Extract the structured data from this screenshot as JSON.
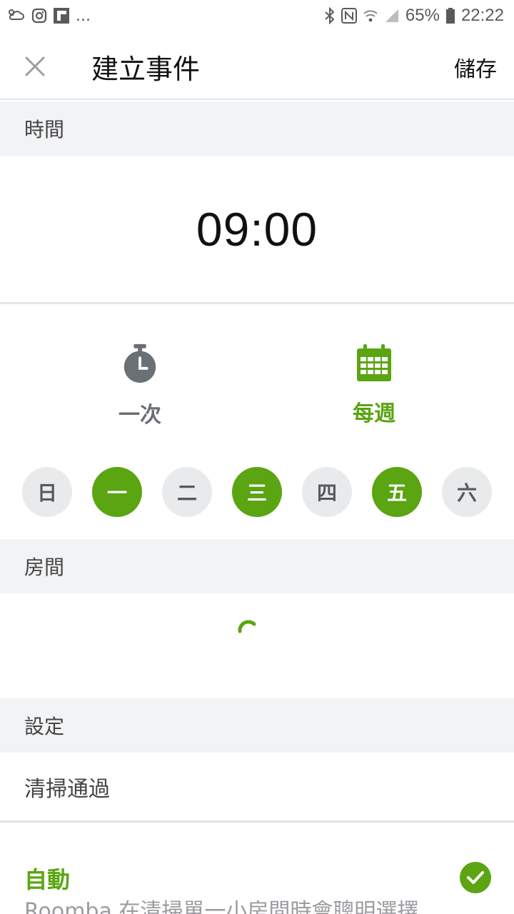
{
  "status_bar": {
    "more_indicator": "...",
    "battery_text": "65%",
    "time": "22:22"
  },
  "header": {
    "title": "建立事件",
    "save_label": "儲存"
  },
  "sections": {
    "time_label": "時間",
    "room_label": "房間",
    "settings_label": "設定"
  },
  "schedule": {
    "time": "09:00",
    "once_label": "一次",
    "weekly_label": "每週",
    "selected_frequency": "weekly",
    "days": [
      {
        "label": "日",
        "selected": false
      },
      {
        "label": "一",
        "selected": true
      },
      {
        "label": "二",
        "selected": false
      },
      {
        "label": "三",
        "selected": true
      },
      {
        "label": "四",
        "selected": false
      },
      {
        "label": "五",
        "selected": true
      },
      {
        "label": "六",
        "selected": false
      }
    ]
  },
  "settings": {
    "cleaning_passes_label": "清掃通過",
    "auto_option": {
      "title": "自動",
      "description": "Roomba 在清掃單一小房間時會聰明選擇",
      "checked": true
    }
  },
  "colors": {
    "accent": "#5aa511",
    "section_bg": "#f2f3f5",
    "day_off_bg": "#e9eaec",
    "icon_gray": "#6b6f76"
  },
  "icons": {
    "close": "close-icon",
    "once": "stopwatch-icon",
    "weekly": "calendar-icon",
    "check": "checkmark-icon"
  }
}
